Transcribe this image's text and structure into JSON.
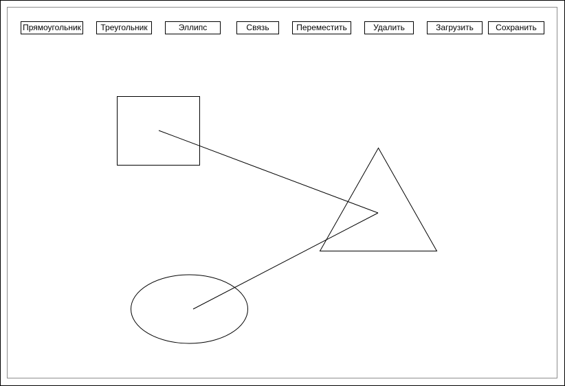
{
  "toolbar": {
    "rectangle": "Прямоугольник",
    "triangle": "Треугольник",
    "ellipse": "Эллипс",
    "link": "Связь",
    "move": "Переместить",
    "delete": "Удалить",
    "load": "Загрузить",
    "save": "Сохранить"
  },
  "canvas": {
    "shapes": [
      "rectangle",
      "triangle",
      "ellipse"
    ],
    "links": [
      {
        "from": "rectangle",
        "to": "triangle"
      },
      {
        "from": "ellipse",
        "to": "triangle"
      }
    ],
    "stroke_color": "#000000",
    "background_color": "#ffffff"
  }
}
